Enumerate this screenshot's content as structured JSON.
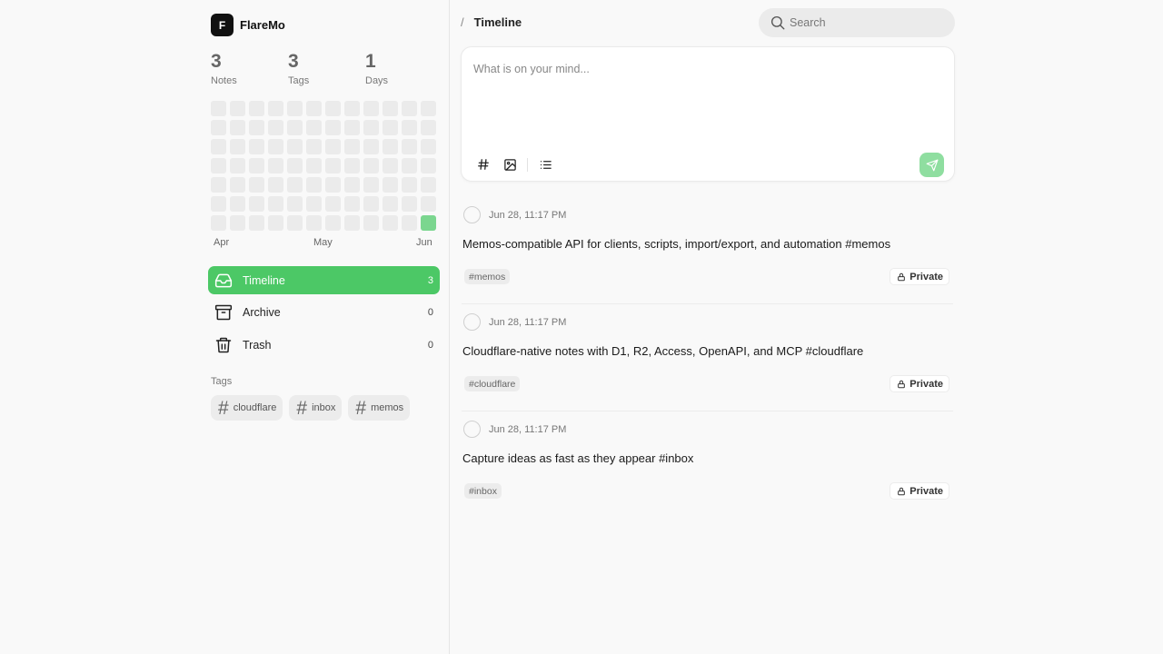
{
  "app": {
    "logo_letter": "F",
    "name": "FlareMo"
  },
  "stats": [
    {
      "value": "3",
      "label": "Notes"
    },
    {
      "value": "3",
      "label": "Tags"
    },
    {
      "value": "1",
      "label": "Days"
    }
  ],
  "heatmap": {
    "rows": 7,
    "cols": 12,
    "active_cells": [
      [
        6,
        11
      ]
    ],
    "active_color": "#7bd68f",
    "empty_color": "#ebebeb"
  },
  "months": [
    "Apr",
    "May",
    "Jun"
  ],
  "nav": [
    {
      "label": "Timeline",
      "count": "3",
      "icon": "inbox-icon",
      "active": true
    },
    {
      "label": "Archive",
      "count": "0",
      "icon": "archive-box-icon",
      "active": false
    },
    {
      "label": "Trash",
      "count": "0",
      "icon": "trash-icon",
      "active": false
    }
  ],
  "tags_section": {
    "title": "Tags",
    "items": [
      "cloudflare",
      "inbox",
      "memos"
    ]
  },
  "header": {
    "separator": "/",
    "breadcrumb": "Timeline"
  },
  "search": {
    "placeholder": "Search",
    "value": ""
  },
  "composer": {
    "placeholder": "What is on your mind...",
    "value": "",
    "tools": [
      "hash-icon",
      "image-icon",
      "list-icon"
    ],
    "send_icon": "send-icon"
  },
  "memos": [
    {
      "time": "Jun 28, 11:17 PM",
      "content": "Memos-compatible API for clients, scripts, import/export, and automation #memos",
      "tag": "#memos",
      "visibility": "Private"
    },
    {
      "time": "Jun 28, 11:17 PM",
      "content": "Cloudflare-native notes with D1, R2, Access, OpenAPI, and MCP #cloudflare",
      "tag": "#cloudflare",
      "visibility": "Private"
    },
    {
      "time": "Jun 28, 11:17 PM",
      "content": "Capture ideas as fast as they appear #inbox",
      "tag": "#inbox",
      "visibility": "Private"
    }
  ],
  "colors": {
    "accent": "#4cc866",
    "send_button": "#8fdea0"
  }
}
